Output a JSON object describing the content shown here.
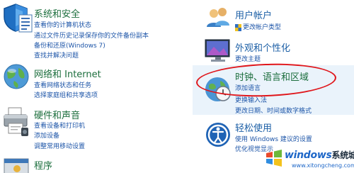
{
  "left": {
    "security": {
      "title": "系统和安全",
      "links": [
        "查看你的计算机状态",
        "通过文件历史记录保存你的文件备份副本",
        "备份和还原(Windows 7)",
        "查找并解决问题"
      ]
    },
    "network": {
      "title": "网络和 Internet",
      "links": [
        "查看网络状态和任务",
        "选择家庭组和共享选项"
      ]
    },
    "hardware": {
      "title": "硬件和声音",
      "links": [
        "查看设备和打印机",
        "添加设备",
        "调整常用移动设置"
      ]
    },
    "programs": {
      "title": "程序"
    }
  },
  "right": {
    "accounts": {
      "title": "用户帐户",
      "links": [
        "更改帐户类型"
      ]
    },
    "appearance": {
      "title": "外观和个性化",
      "links": [
        "更改主题"
      ]
    },
    "clock": {
      "title": "时钟、语言和区域",
      "links": [
        "添加语言",
        "更换输入法",
        "更改日期、时间或数字格式"
      ]
    },
    "ease": {
      "title": "轻松使用",
      "links": [
        "使用 Windows 建议的设置",
        "优化视觉显示"
      ]
    }
  },
  "watermark": {
    "brand": "windows",
    "cn": "系统城",
    "url": "www.xitongcheng.com"
  },
  "colors": {
    "category_title": "#1c6e3d",
    "link": "#1d55a8",
    "highlight_ring": "#e0161b",
    "highlight_band": "#eaf3fb"
  },
  "icons": [
    "shield-icon",
    "network-globe-icon",
    "printer-icon",
    "programs-icon",
    "user-accounts-icon",
    "monitor-icon",
    "clock-globe-icon",
    "ease-of-access-icon",
    "windows-logo-icon"
  ]
}
